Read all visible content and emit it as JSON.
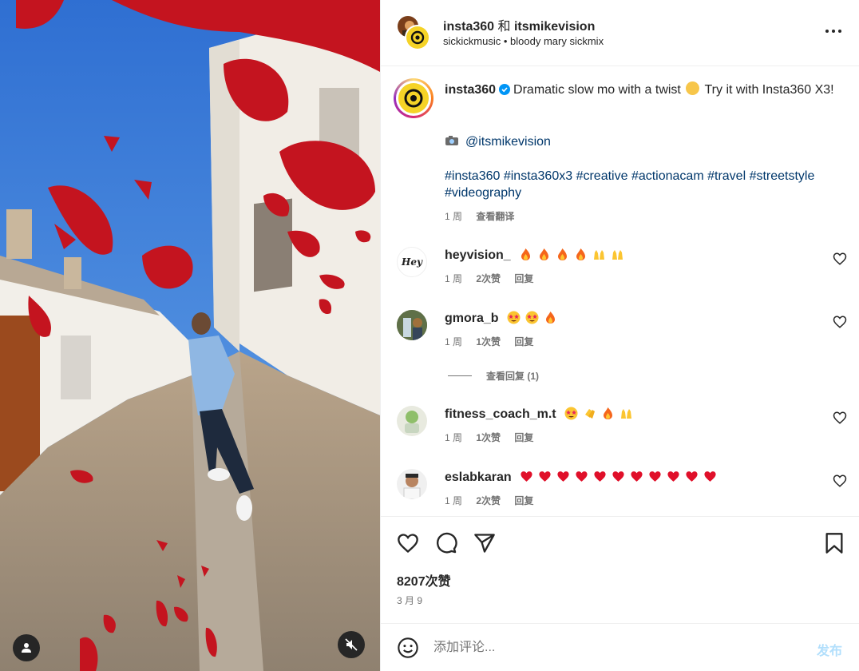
{
  "header": {
    "author": "insta360",
    "connector": "和",
    "collaborator": "itsmikevision",
    "audio_artist": "sickickmusic",
    "separator": "•",
    "audio_track": "bloody mary sickmix"
  },
  "caption": {
    "username": "insta360",
    "text_before_emoji": "Dramatic slow mo with a twist",
    "text_after_emoji": "Try it with Insta360 X3!",
    "mention": "@itsmikevision",
    "hashtags": "#insta360 #insta360x3 #creative #actionacam #travel #streetstyle #videography",
    "age": "1 周",
    "translate_label": "查看翻译"
  },
  "comments": [
    {
      "username": "heyvision_",
      "emojis": [
        "fire",
        "fire",
        "fire",
        "fire",
        "raising-hands",
        "raising-hands"
      ],
      "age": "1 周",
      "likes": "2次赞",
      "reply_label": "回复",
      "avatar_text": "Hey"
    },
    {
      "username": "gmora_b",
      "emojis": [
        "star-struck",
        "star-struck",
        "fire"
      ],
      "age": "1 周",
      "likes": "1次赞",
      "reply_label": "回复"
    },
    {
      "username": "fitness_coach_m.t",
      "emojis": [
        "star-struck",
        "clapping-hands",
        "fire",
        "raising-hands"
      ],
      "age": "1 周",
      "likes": "1次赞",
      "reply_label": "回复"
    },
    {
      "username": "eslabkaran",
      "emojis": [
        "heart",
        "heart",
        "heart",
        "heart",
        "heart",
        "heart",
        "heart",
        "heart",
        "heart",
        "heart",
        "heart"
      ],
      "age": "1 周",
      "likes": "2次赞",
      "reply_label": "回复"
    }
  ],
  "view_replies": "查看回复 (1)",
  "actions": {
    "likes_count": "8207次赞",
    "date": "3 月 9",
    "icons": [
      "heart-icon",
      "comment-icon",
      "share-icon",
      "bookmark-icon"
    ]
  },
  "comment_box": {
    "placeholder": "添加评论...",
    "post_label": "发布"
  },
  "colors": {
    "link": "#00376b",
    "secondary_text": "#737373",
    "post_disabled": "#b2dffc",
    "brand_yellow": "#f5d327"
  }
}
